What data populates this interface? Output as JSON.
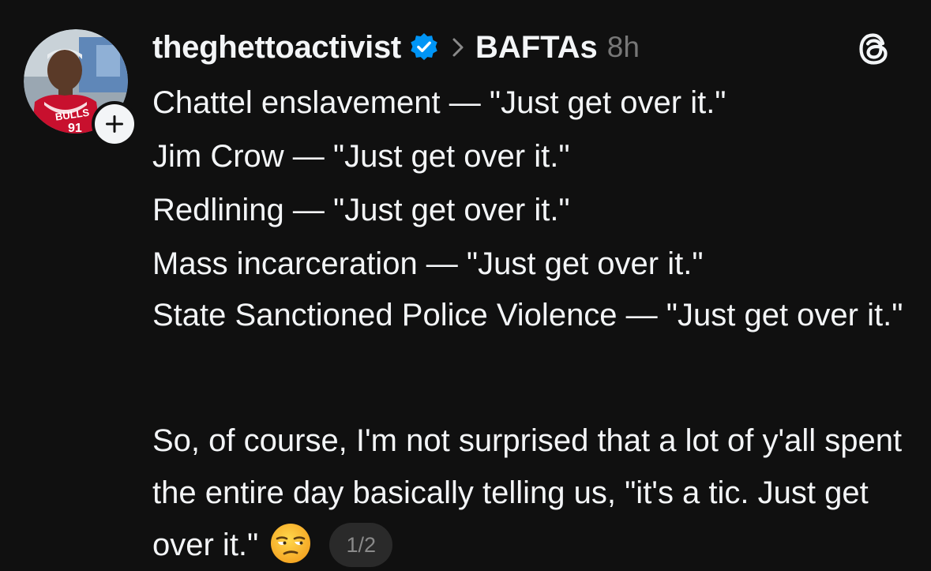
{
  "post": {
    "author": {
      "username": "theghettoactivist",
      "verified": true,
      "avatar_icon": "profile-photo-icon",
      "follow_icon": "plus-icon"
    },
    "topic": "BAFTAs",
    "time": "8h",
    "app_icon": "threads-logo-icon",
    "lines": [
      "Chattel enslavement — \"Just get over it.\"",
      "Jim Crow — \"Just get over it.\"",
      "Redlining — \"Just get over it.\"",
      "Mass incarceration — \"Just get over it.\"",
      "State Sanctioned Police Violence — \"Just get over it.\""
    ],
    "paragraph2": "So, of course, I'm not surprised that a lot of y'all spent the entire day basically telling us, \"it's a tic. Just get over it.\"",
    "emoji": "😒",
    "pagination": "1/2"
  },
  "colors": {
    "background": "#101010",
    "text": "#f3f5f7",
    "muted": "#777777",
    "verified_badge": "#0095f6",
    "pill_bg": "#2a2a2a"
  }
}
